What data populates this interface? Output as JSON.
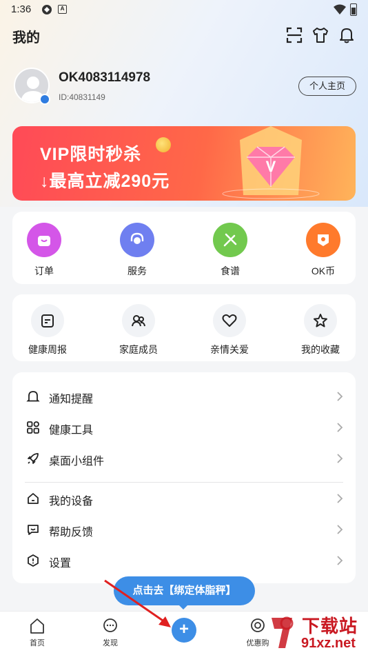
{
  "status_bar": {
    "time": "1:36",
    "notification_icon": "A"
  },
  "header": {
    "title": "我的",
    "icons": [
      "scan-icon",
      "shirt-icon",
      "bell-icon"
    ]
  },
  "profile": {
    "username": "OK4083114978",
    "user_id": "ID:40831149",
    "homepage_button": "个人主页"
  },
  "vip_banner": {
    "title": "VIP限时秒杀",
    "subtitle": "↓最高立减290元"
  },
  "quick_services": [
    {
      "label": "订单",
      "icon": "bag-icon",
      "color": "#d456e8"
    },
    {
      "label": "服务",
      "icon": "headset-icon",
      "color": "#6f7ff0"
    },
    {
      "label": "食谱",
      "icon": "utensils-icon",
      "color": "#72c94e"
    },
    {
      "label": "OK币",
      "icon": "ok-coin-icon",
      "color": "#ff7a2c"
    }
  ],
  "family_tools": [
    {
      "label": "健康周报",
      "icon": "report-icon"
    },
    {
      "label": "家庭成员",
      "icon": "family-icon"
    },
    {
      "label": "亲情关爱",
      "icon": "heart-icon"
    },
    {
      "label": "我的收藏",
      "icon": "star-icon"
    }
  ],
  "menu_group1": [
    {
      "label": "通知提醒",
      "icon": "bell-icon"
    },
    {
      "label": "健康工具",
      "icon": "grid-icon"
    },
    {
      "label": "桌面小组件",
      "icon": "rocket-icon"
    }
  ],
  "menu_group2": [
    {
      "label": "我的设备",
      "icon": "device-icon"
    },
    {
      "label": "帮助反馈",
      "icon": "feedback-icon"
    },
    {
      "label": "设置",
      "icon": "settings-icon"
    }
  ],
  "tooltip": {
    "text": "点击去【绑定体脂秤】"
  },
  "bottom_nav": [
    {
      "label": "首页",
      "icon": "home-icon"
    },
    {
      "label": "发现",
      "icon": "chat-icon"
    },
    {
      "label": "+",
      "icon": "add-icon"
    },
    {
      "label": "优惠购",
      "icon": "coupon-icon"
    }
  ],
  "watermark": {
    "line1": "下载站",
    "line2": "91xz.net"
  }
}
